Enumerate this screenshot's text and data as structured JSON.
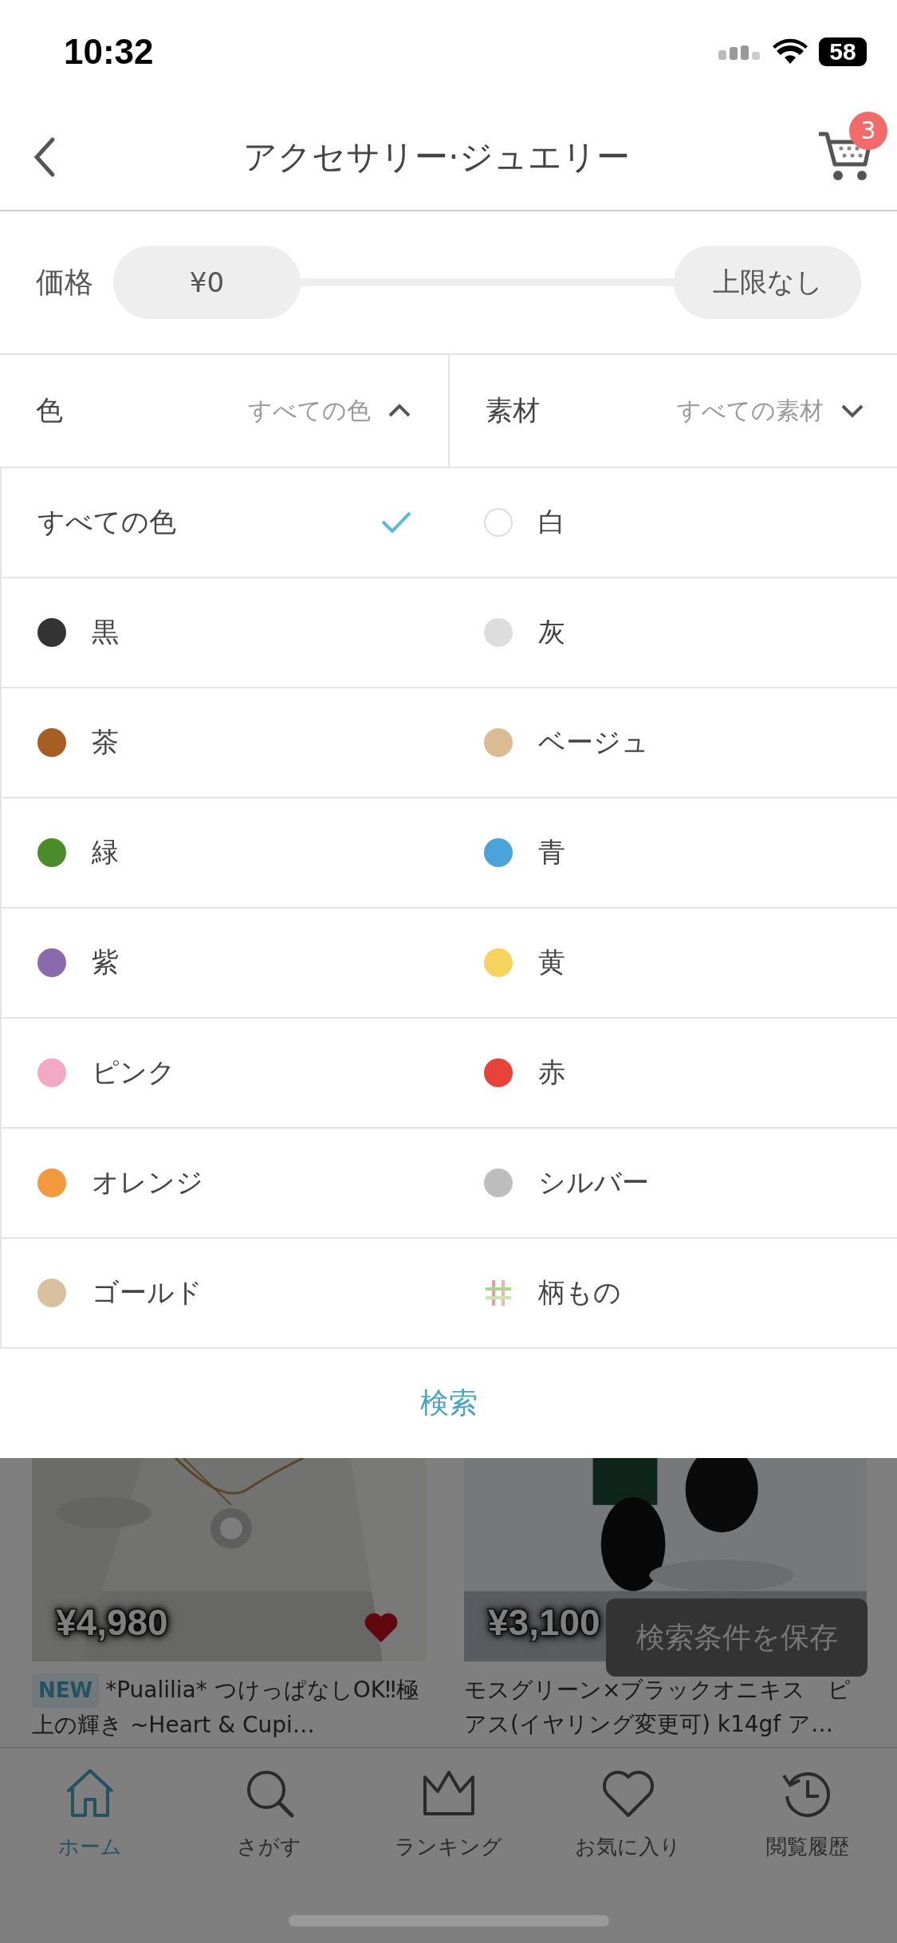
{
  "status_bar": {
    "time": "10:32",
    "battery": "58"
  },
  "nav": {
    "title": "アクセサリー·ジュエリー",
    "cart_badge": "3"
  },
  "price": {
    "label": "価格",
    "min": "¥0",
    "max": "上限なし"
  },
  "filters": [
    {
      "label": "色",
      "value": "すべての色",
      "expanded": true
    },
    {
      "label": "素材",
      "value": "すべての素材",
      "expanded": false
    }
  ],
  "colors": [
    {
      "label": "すべての色",
      "kind": "all",
      "selected": true
    },
    {
      "label": "白",
      "kind": "swatch",
      "color": "#ffffff"
    },
    {
      "label": "黒",
      "kind": "swatch",
      "color": "#333333"
    },
    {
      "label": "灰",
      "kind": "swatch",
      "color": "#dddddd"
    },
    {
      "label": "茶",
      "kind": "swatch",
      "color": "#a85d22"
    },
    {
      "label": "ベージュ",
      "kind": "swatch",
      "color": "#dbbb91"
    },
    {
      "label": "緑",
      "kind": "swatch",
      "color": "#4a8c2a"
    },
    {
      "label": "青",
      "kind": "swatch",
      "color": "#4aa3d9"
    },
    {
      "label": "紫",
      "kind": "swatch",
      "color": "#8a6aac"
    },
    {
      "label": "黄",
      "kind": "swatch",
      "color": "#f7d45e"
    },
    {
      "label": "ピンク",
      "kind": "swatch",
      "color": "#f2a9c4"
    },
    {
      "label": "赤",
      "kind": "swatch",
      "color": "#e8433a"
    },
    {
      "label": "オレンジ",
      "kind": "swatch",
      "color": "#f39a3e"
    },
    {
      "label": "シルバー",
      "kind": "swatch",
      "color": "#bdbdbd"
    },
    {
      "label": "ゴールド",
      "kind": "swatch",
      "color": "#d9c1a0"
    },
    {
      "label": "柄もの",
      "kind": "pattern"
    }
  ],
  "search_button": "検索",
  "products": [
    {
      "price": "¥4,980",
      "badge": "NEW",
      "name": "*Pualilia* つけっぱなしOK‼極上の輝き ~Heart & Cupi…",
      "favorite": true,
      "kind": "necklace"
    },
    {
      "price": "¥3,100",
      "name": "モスグリーン×ブラックオニキス　ピアス(イヤリング変更可) k14gf ア…",
      "kind": "earring"
    }
  ],
  "save_button": "検索条件を保存",
  "tabs": [
    {
      "label": "ホーム",
      "selected": true
    },
    {
      "label": "さがす",
      "selected": false
    },
    {
      "label": "ランキング",
      "selected": false
    },
    {
      "label": "お気に入り",
      "selected": false
    },
    {
      "label": "閲覧履歴",
      "selected": false
    }
  ]
}
